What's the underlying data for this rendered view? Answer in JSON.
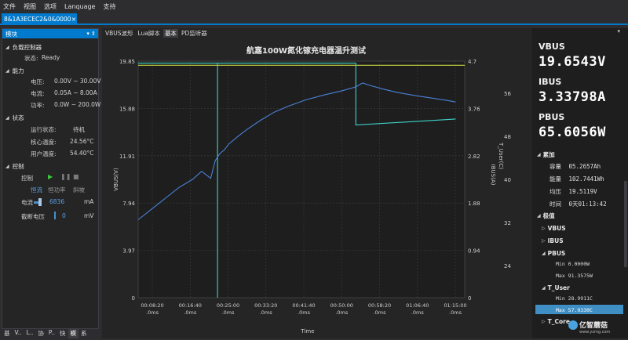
{
  "menu": [
    "文件",
    "视图",
    "选项",
    "Lanquage",
    "支持"
  ],
  "doc_tab": {
    "title": "8&1A3ECEC2&0&0000",
    "close": "×"
  },
  "left_panel": {
    "header": "模块",
    "pin": "▾ ⇕",
    "groups": {
      "load": "负载控制器",
      "ability": "能力",
      "status": "状态",
      "control": "控制"
    },
    "load_status": {
      "label": "状态:",
      "value": "Ready"
    },
    "ability": [
      {
        "k": "电压:",
        "v": "0.00V ~ 30.00V"
      },
      {
        "k": "电流:",
        "v": "0.05A ~ 8.00A"
      },
      {
        "k": "功率:",
        "v": "0.0W ~ 200.0W"
      }
    ],
    "status": [
      {
        "k": "运行状态:",
        "v": "待机"
      },
      {
        "k": "核心温度:",
        "v": "24.56°C"
      },
      {
        "k": "用户温度:",
        "v": "54.40°C"
      }
    ],
    "control": {
      "label": "控制",
      "modes": [
        "恒流",
        "恒功率",
        "斜坡"
      ],
      "current_label": "电流",
      "current_value": "6836",
      "current_unit": "mA",
      "cutoff_label": "截断电压",
      "cutoff_value": "0",
      "cutoff_unit": "mV"
    },
    "bottom_tabs": [
      "基",
      "V..",
      "L..",
      "协",
      "P..",
      "快",
      "模",
      "系"
    ]
  },
  "main_tabs": [
    "VBUS波形",
    "Lua脚本",
    "基本",
    "PD监听器"
  ],
  "chart_data": {
    "type": "line",
    "title": "航嘉100W氮化镓充电器温升测试",
    "xlabel": "Time",
    "x_ticks": [
      "00:08:20\n.0ms",
      "00:16:40\n.0ms",
      "00:25:00\n.0ms",
      "00:33:20\n.0ms",
      "00:41:40\n.0ms",
      "00:50:00\n.0ms",
      "00:58:20\n.0ms",
      "01:06:40\n.0ms",
      "01:15:00\n.0ms"
    ],
    "x_range_min": [
      3,
      75
    ],
    "y_left": {
      "label": "VBUS(V)",
      "range": [
        0,
        19.85
      ],
      "ticks": [
        "0",
        "3.97",
        "7.94",
        "11.91",
        "15.88",
        "19.85"
      ]
    },
    "y_right1": {
      "label": "IBUS(A)",
      "range": [
        0,
        4.7
      ],
      "ticks": [
        "0",
        "0.94",
        "1.88",
        "2.82",
        "3.76",
        "4.7"
      ]
    },
    "y_right2": {
      "label": "T_User(C)",
      "range": [
        18,
        62
      ],
      "ticks": [
        "24",
        "32",
        "40",
        "48",
        "56"
      ]
    },
    "series": [
      {
        "name": "VBUS",
        "color": "#c8d83c",
        "points": [
          [
            3,
            19.5
          ],
          [
            75,
            19.5
          ]
        ]
      },
      {
        "name": "IBUS",
        "color": "#3fd3c8",
        "points": [
          [
            3,
            4.66
          ],
          [
            20.5,
            4.66
          ],
          [
            20.5,
            0
          ],
          [
            20.5,
            4.66
          ],
          [
            51,
            4.66
          ],
          [
            51,
            3.43
          ],
          [
            73,
            3.55
          ]
        ]
      },
      {
        "name": "T_User",
        "color": "#4a82d8",
        "points": [
          [
            3,
            32.5
          ],
          [
            6,
            34.5
          ],
          [
            9,
            36.5
          ],
          [
            12,
            38.5
          ],
          [
            15,
            40
          ],
          [
            17,
            41.5
          ],
          [
            19,
            40.2
          ],
          [
            20,
            43.5
          ],
          [
            21,
            44.8
          ],
          [
            22,
            45.5
          ],
          [
            23,
            46.6
          ],
          [
            25,
            48
          ],
          [
            27,
            49.3
          ],
          [
            30,
            51
          ],
          [
            33,
            52.5
          ],
          [
            36,
            53.6
          ],
          [
            40,
            54.8
          ],
          [
            44,
            55.7
          ],
          [
            48,
            56.5
          ],
          [
            51,
            57.2
          ],
          [
            52.5,
            57.93
          ],
          [
            54,
            57.5
          ],
          [
            57,
            56.8
          ],
          [
            60,
            56.2
          ],
          [
            64,
            55.6
          ],
          [
            68,
            55.1
          ],
          [
            71,
            54.7
          ],
          [
            73,
            54.4
          ]
        ]
      }
    ],
    "grid": true,
    "legend": "none"
  },
  "right_panel": {
    "vbus_label": "VBUS",
    "vbus_value": "19.6543V",
    "ibus_label": "IBUS",
    "ibus_value": "3.33798A",
    "pbus_label": "PBUS",
    "pbus_value": "65.6056W",
    "accum_label": "累加",
    "accum": [
      {
        "k": "容量",
        "v": "05.2657Ah"
      },
      {
        "k": "能量",
        "v": "102.7441Wh"
      },
      {
        "k": "均压",
        "v": "19.5119V"
      },
      {
        "k": "时间",
        "v": "0天01:13:42"
      }
    ],
    "extreme_label": "极值",
    "ext_vbus": "VBUS",
    "ext_ibus": "IBUS",
    "ext_pbus": "PBUS",
    "pbus_min": "Min 0.0000W",
    "pbus_max": "Max 91.3575W",
    "ext_tuser": "T_User",
    "tuser_min": "Min 28.9911C",
    "tuser_max": "Max 57.9330C",
    "ext_tcore": "T_Core"
  },
  "watermark": {
    "text": "亿智蘑菇",
    "sub": "www.yzmg.com"
  },
  "colors": {
    "accent": "#007acc",
    "vbus": "#c8d83c",
    "ibus": "#3fd3c8",
    "tuser": "#4a82d8"
  }
}
